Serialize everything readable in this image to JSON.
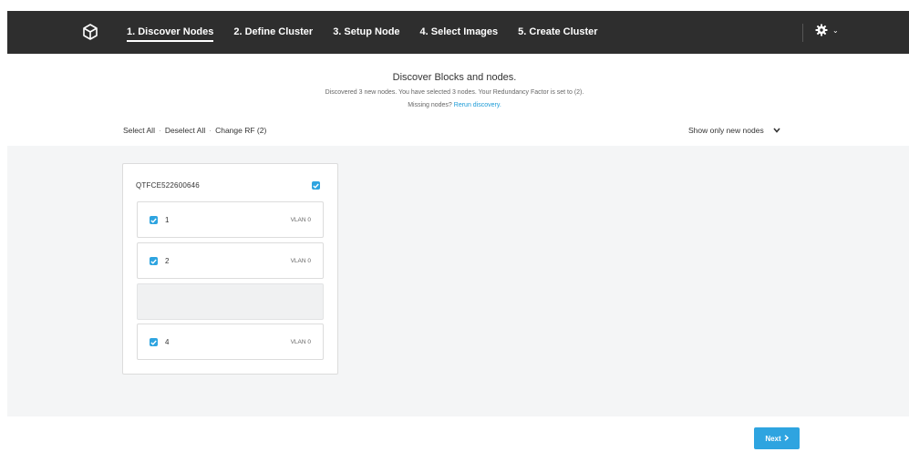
{
  "nav": {
    "steps": [
      {
        "label": "1. Discover Nodes",
        "active": true
      },
      {
        "label": "2. Define Cluster",
        "active": false
      },
      {
        "label": "3. Setup Node",
        "active": false
      },
      {
        "label": "4. Select Images",
        "active": false
      },
      {
        "label": "5. Create Cluster",
        "active": false
      }
    ],
    "logo_icon": "cube-icon",
    "settings_icon": "gear-icon"
  },
  "header": {
    "title": "Discover Blocks and nodes.",
    "subtitle": "Discovered 3 new nodes. You have selected 3 nodes. Your Redundancy Factor is set to (2).",
    "missing_text": "Missing nodes?",
    "rerun_link": "Rerun discovery."
  },
  "actions": {
    "select_all": "Select All",
    "deselect_all": "Deselect All",
    "change_rf": "Change RF (2)",
    "separator": "·"
  },
  "filter": {
    "selected": "Show only new nodes"
  },
  "block": {
    "id": "QTFCE522600646",
    "checked": true,
    "nodes": [
      {
        "position": "1",
        "vlan": "VLAN 0",
        "checked": true,
        "empty": false
      },
      {
        "position": "2",
        "vlan": "VLAN 0",
        "checked": true,
        "empty": false
      },
      {
        "position": "",
        "vlan": "",
        "checked": false,
        "empty": true
      },
      {
        "position": "4",
        "vlan": "VLAN 0",
        "checked": true,
        "empty": false
      }
    ]
  },
  "footer": {
    "next_label": "Next"
  },
  "colors": {
    "nav_bg": "#2e2e2e",
    "accent": "#2ea4e0",
    "content_bg": "#f4f5f6"
  }
}
